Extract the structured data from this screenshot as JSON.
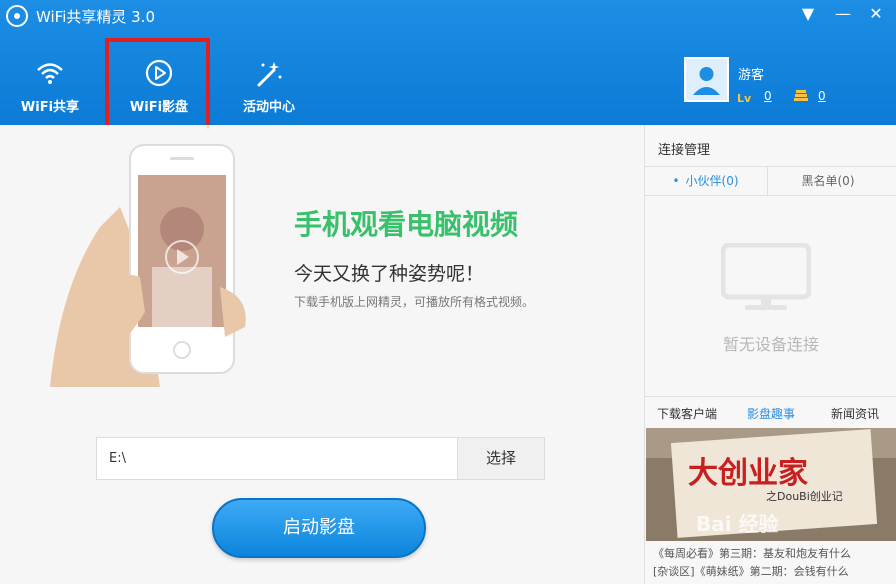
{
  "app": {
    "title": "WiFi共享精灵 3.0"
  },
  "window_controls": {
    "menu": "▼",
    "minimize": "—",
    "close": "✕"
  },
  "nav": [
    {
      "label": "WiFi共享",
      "icon": "wifi-icon"
    },
    {
      "label": "WiFi影盘",
      "icon": "play-icon"
    },
    {
      "label": "活动中心",
      "icon": "magic-wand-icon"
    }
  ],
  "user": {
    "name": "游客",
    "level_badge": "Lv",
    "level": "0",
    "coins": "0"
  },
  "promo": {
    "title": "手机观看电脑视频",
    "subtitle": "今天又换了种姿势呢！",
    "desc": "下载手机版上网精灵，可播放所有格式视频。"
  },
  "path": {
    "value": "E:\\"
  },
  "buttons": {
    "select": "选择",
    "start": "启动影盘"
  },
  "side": {
    "title": "连接管理",
    "tabs": {
      "partners": "小伙伴(0)",
      "blacklist": "黑名单(0)"
    },
    "empty": "暂无设备连接",
    "bottom_tabs": {
      "download": "下载客户端",
      "fun": "影盘趣事",
      "news": "新闻资讯"
    },
    "banner": {
      "text_main": "大创业家",
      "text_small": "之DouBi创业记",
      "watermark": "Bai 经验"
    },
    "news": [
      "《每周必看》第三期：基友和炮友有什么",
      "[杂谈区]《萌妹纸》第二期：会钱有什么"
    ]
  },
  "colors": {
    "header": "#1d8ee4",
    "accent_green": "#38c06a",
    "highlight_red": "#e02020",
    "link_blue": "#2b8ee0"
  }
}
